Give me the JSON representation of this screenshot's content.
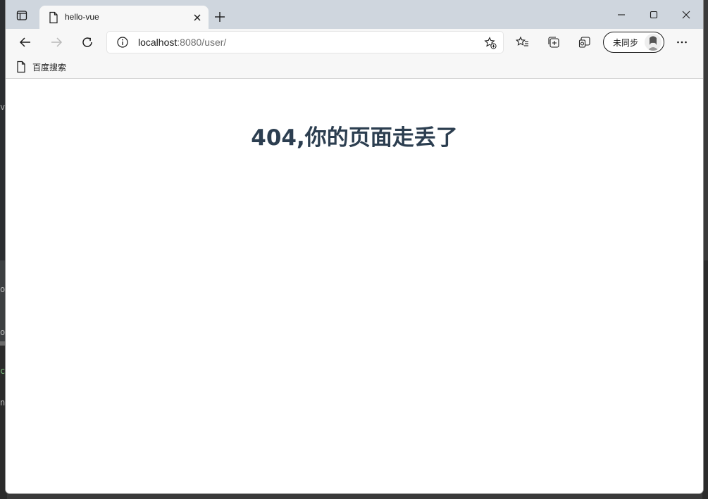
{
  "tab": {
    "title": "hello-vue"
  },
  "address": {
    "host": "localhost",
    "rest": ":8080/user/"
  },
  "profile": {
    "label": "未同步"
  },
  "bookmarks": [
    {
      "label": "百度搜索"
    }
  ],
  "page": {
    "heading": "404,你的页面走丢了"
  },
  "background_text": {
    "g1": "v",
    "g2": "o",
    "g3": "o",
    "g4": "c",
    "g5": "n"
  },
  "colors": {
    "heading": "#2c3e50",
    "tabstrip": "#cfd6de",
    "toolbar": "#f7f7f7"
  },
  "icons": {
    "tab_actions": "tab-actions-icon",
    "doc": "document-icon",
    "close": "close-icon",
    "new_tab": "plus-icon",
    "back": "arrow-left-icon",
    "forward": "arrow-right-icon",
    "refresh": "refresh-icon",
    "info": "info-icon",
    "add_favorite": "star-plus-icon",
    "favorites": "favorites-list-icon",
    "collections": "collections-icon",
    "browser_essentials": "browser-essentials-icon",
    "more": "more-icon"
  }
}
